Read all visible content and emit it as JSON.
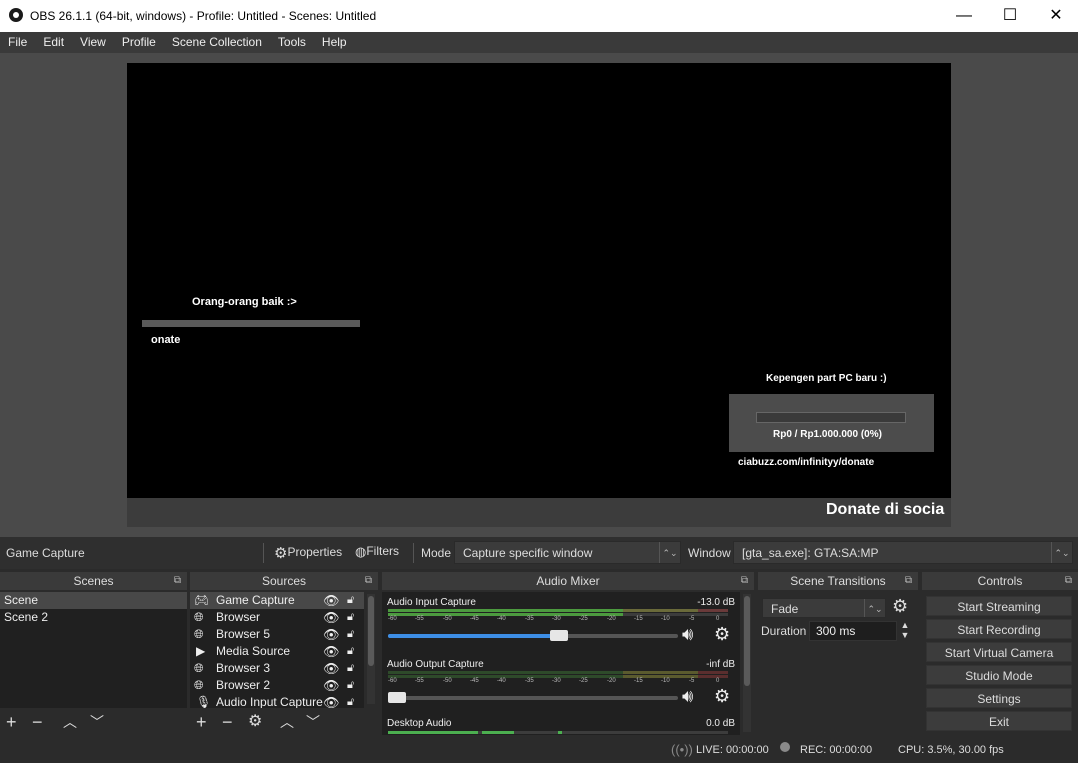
{
  "window": {
    "title": "OBS 26.1.1 (64-bit, windows) - Profile: Untitled - Scenes: Untitled",
    "minimize": "—",
    "maximize": "☐",
    "close": "✕"
  },
  "menu": [
    "File",
    "Edit",
    "View",
    "Profile",
    "Scene Collection",
    "Tools",
    "Help"
  ],
  "preview": {
    "overlay_left_title": "Orang-orang baik :>",
    "overlay_left_sub": "onate",
    "overlay_right_title": "Kepengen part PC baru :)",
    "overlay_right_progress": "Rp0 / Rp1.000.000 (0%)",
    "overlay_right_link": "ciabuzz.com/infinityy/donate",
    "ticker": "Donate di socia"
  },
  "source_toolbar": {
    "selected_source": "Game Capture",
    "properties": "Properties",
    "filters": "Filters",
    "mode_label": "Mode",
    "mode_value": "Capture specific window",
    "window_label": "Window",
    "window_value": "[gta_sa.exe]: GTA:SA:MP"
  },
  "scenes": {
    "title": "Scenes",
    "items": [
      "Scene",
      "Scene 2"
    ]
  },
  "sources": {
    "title": "Sources",
    "items": [
      "Game Capture",
      "Browser",
      "Browser 5",
      "Media Source",
      "Browser 3",
      "Browser 2",
      "Audio Input Capture"
    ]
  },
  "mixer": {
    "title": "Audio Mixer",
    "scale_ticks": [
      "-60",
      "-55",
      "-50",
      "-45",
      "-40",
      "-35",
      "-30",
      "-25",
      "-20",
      "-15",
      "-10",
      "-5",
      "0"
    ],
    "channels": [
      {
        "name": "Audio Input Capture",
        "level": "-13.0 dB",
        "volume": 0.59
      },
      {
        "name": "Audio Output Capture",
        "level": "-inf dB",
        "volume": 0.0
      },
      {
        "name": "Desktop Audio",
        "level": "0.0 dB"
      }
    ]
  },
  "transitions": {
    "title": "Scene Transitions",
    "type": "Fade",
    "duration_label": "Duration",
    "duration_value": "300 ms"
  },
  "controls": {
    "title": "Controls",
    "buttons": [
      "Start Streaming",
      "Start Recording",
      "Start Virtual Camera",
      "Studio Mode",
      "Settings",
      "Exit"
    ]
  },
  "status": {
    "live": "LIVE: 00:00:00",
    "rec": "REC: 00:00:00",
    "cpu": "CPU: 3.5%, 30.00 fps"
  },
  "colors": {
    "accent": "#3d8ee6",
    "meter_green": "#4caf50",
    "meter_yellow": "#c8b432",
    "meter_red": "#c83232"
  }
}
